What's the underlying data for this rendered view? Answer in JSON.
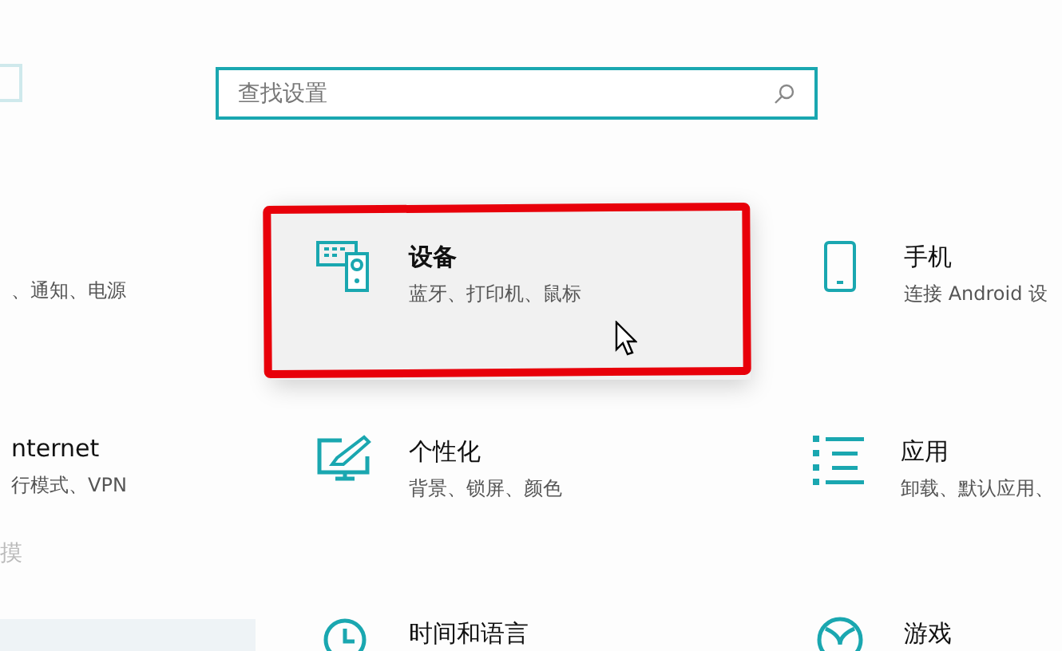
{
  "search": {
    "placeholder": "查找设置"
  },
  "side_text": "摸",
  "tiles": [
    {
      "subtitle": "、通知、电源",
      "selected": false
    },
    {
      "title": "设备",
      "subtitle": "蓝牙、打印机、鼠标",
      "selected": true
    },
    {
      "title": "手机",
      "subtitle": "连接 Android 设",
      "selected": false
    },
    {
      "title": "nternet",
      "subtitle": "行模式、VPN",
      "selected": false
    },
    {
      "title": "个性化",
      "subtitle": "背景、锁屏、颜色",
      "selected": false
    },
    {
      "title": "应用",
      "subtitle": "卸载、默认应用、",
      "selected": false
    },
    {
      "title": "时间和语言",
      "selected": false
    },
    {
      "title": "游戏",
      "selected": false
    }
  ]
}
